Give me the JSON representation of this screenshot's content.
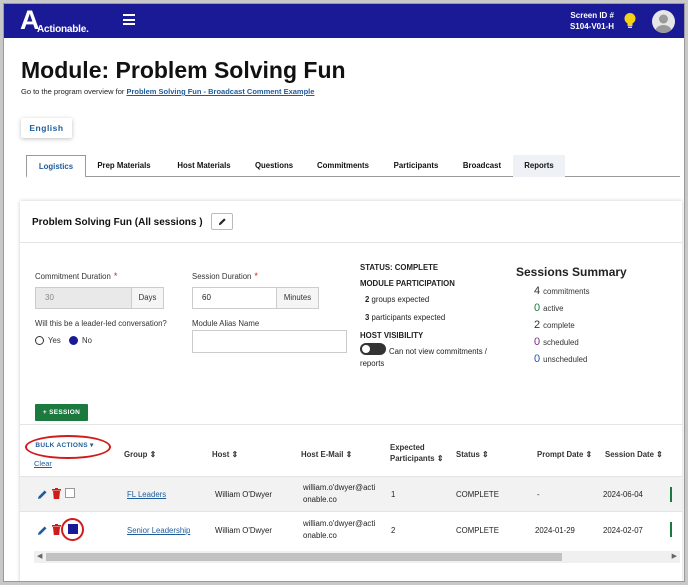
{
  "brand": {
    "name": "Actionable.",
    "mark": "A"
  },
  "header": {
    "screen_id_label": "Screen ID #",
    "screen_id_value": "S104-V01-H"
  },
  "page": {
    "title": "Module: Problem Solving Fun",
    "subline_prefix": "Go to the program overview for ",
    "subline_link": "Problem Solving Fun - Broadcast Comment Example",
    "language_button": "English"
  },
  "tabs": [
    "Logistics",
    "Prep Materials",
    "Host Materials",
    "Questions",
    "Commitments",
    "Participants",
    "Broadcast",
    "Reports"
  ],
  "module": {
    "title": "Problem Solving Fun (All sessions )",
    "commitment_duration_label": "Commitment Duration",
    "commitment_duration_value": "30",
    "commitment_duration_unit": "Days",
    "session_duration_label": "Session Duration",
    "session_duration_value": "60",
    "session_duration_unit": "Minutes",
    "required_mark": "*",
    "leader_led_question": "Will this be a leader-led conversation?",
    "yes_label": "Yes",
    "no_label": "No",
    "selected": "No",
    "alias_label": "Module Alias Name",
    "alias_value": ""
  },
  "status": {
    "status_text": "STATUS: COMPLETE",
    "participation_heading": "MODULE PARTICIPATION",
    "groups_count": "2",
    "groups_label": "groups expected",
    "participants_count": "3",
    "participants_label": "participants expected",
    "host_visibility_heading": "HOST VISIBILITY",
    "host_visibility_text_1": "Can not view commitments /",
    "host_visibility_text_2": "reports"
  },
  "summary": {
    "title": "Sessions Summary",
    "rows": [
      {
        "count": "4",
        "label": "commitments",
        "color": "#222222"
      },
      {
        "count": "0",
        "label": "active",
        "color": "#1c7a3e"
      },
      {
        "count": "2",
        "label": "complete",
        "color": "#222222"
      },
      {
        "count": "0",
        "label": "scheduled",
        "color": "#7a2a8a"
      },
      {
        "count": "0",
        "label": "unscheduled",
        "color": "#1f5c9c"
      }
    ]
  },
  "actions": {
    "add_session": "+ SESSION",
    "bulk_actions": "BULK ACTIONS",
    "clear": "Clear"
  },
  "table": {
    "columns": [
      "Group",
      "Host",
      "Host E-Mail",
      "Expected Participants",
      "Status",
      "Prompt Date",
      "Session Date"
    ],
    "sort_glyph": "⇕",
    "rows": [
      {
        "group": "FL Leaders",
        "host": "William O'Dwyer",
        "email_1": "william.o'dwyer@acti",
        "email_2": "onable.co",
        "expected": "1",
        "status": "COMPLETE",
        "prompt_date": "-",
        "session_date": "2024-06-04",
        "checked": false
      },
      {
        "group": "Senior Leadership",
        "host": "William O'Dwyer",
        "email_1": "william.o'dwyer@acti",
        "email_2": "onable.co",
        "expected": "2",
        "status": "COMPLETE",
        "prompt_date": "2024-01-29",
        "session_date": "2024-02-07",
        "checked": true
      }
    ]
  },
  "colors": {
    "nav": "#1a1a96",
    "link": "#1f5c9c",
    "required": "#d01b1b",
    "primary_green": "#1c7a3e",
    "delete_red": "#d01b1b"
  },
  "icons": [
    "menu-icon",
    "lightbulb-icon",
    "avatar-icon",
    "pencil-icon",
    "trash-icon",
    "chevron-left-icon",
    "chevron-right-icon"
  ]
}
